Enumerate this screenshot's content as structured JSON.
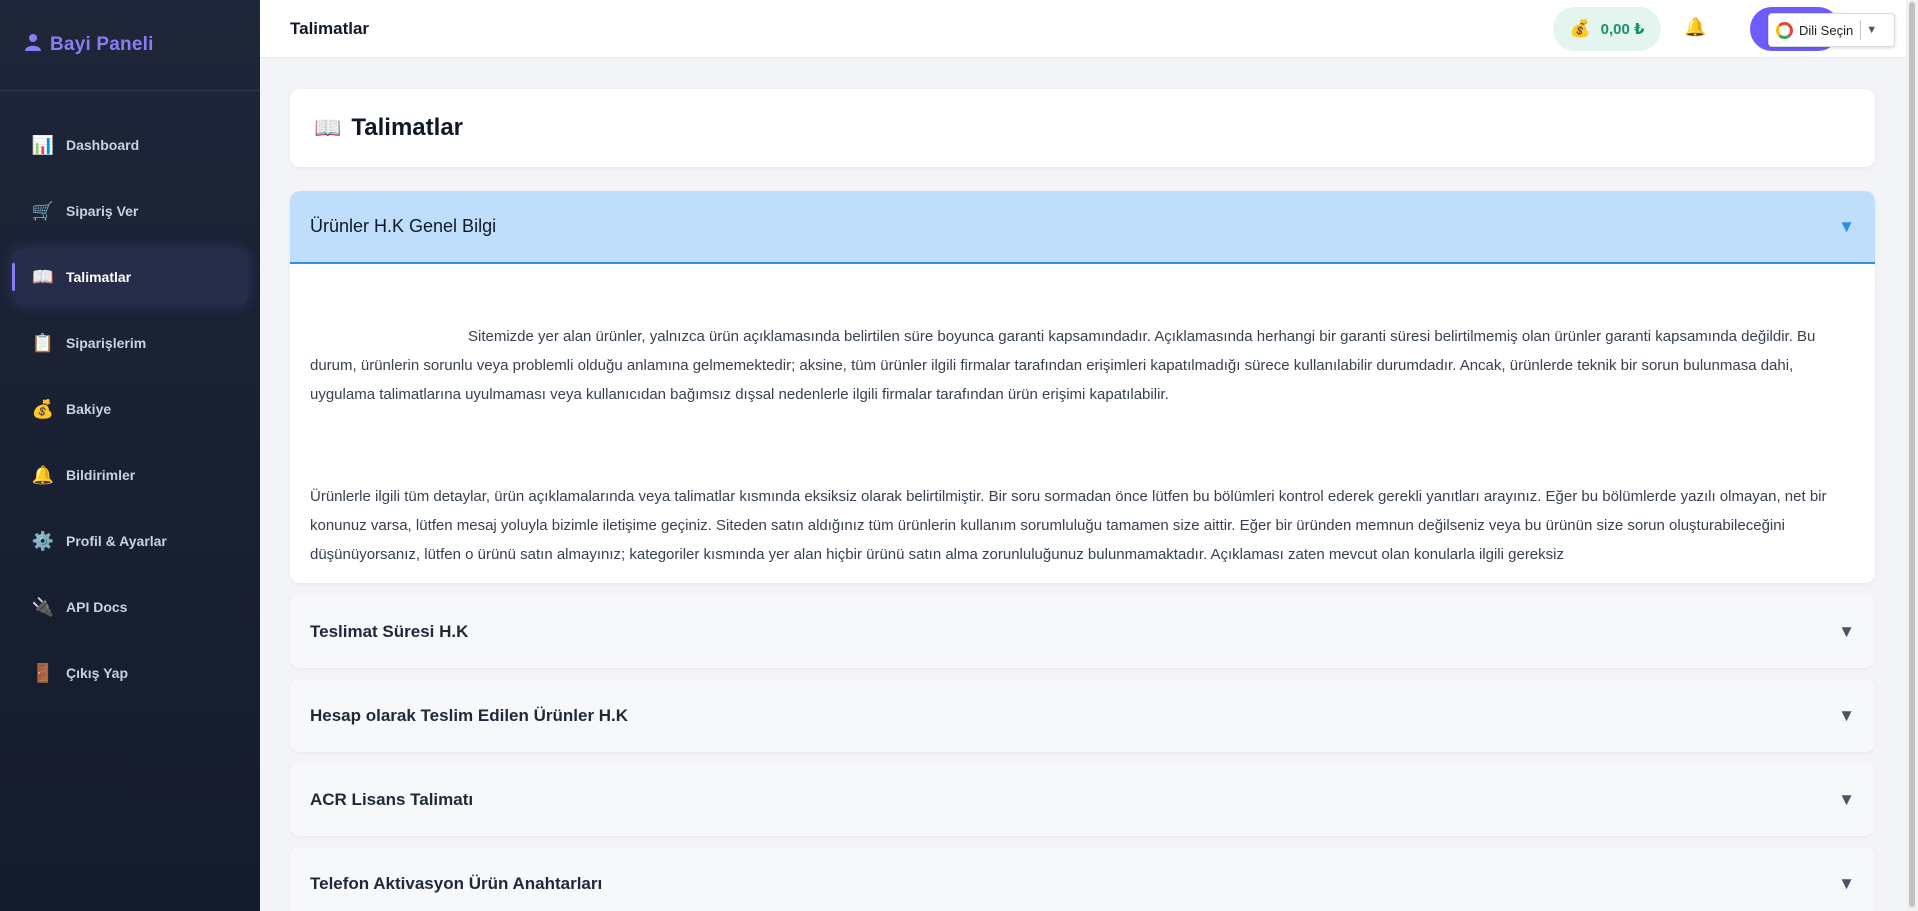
{
  "brand": {
    "icon": "user-icon",
    "title": "Bayi Paneli",
    "color": "#8b7cf6"
  },
  "sidebar": {
    "items": [
      {
        "icon": "📊",
        "icon_name": "dashboard-chart-icon",
        "label": "Dashboard",
        "active": false
      },
      {
        "icon": "🛒",
        "icon_name": "cart-icon",
        "label": "Sipariş Ver",
        "active": false
      },
      {
        "icon": "📖",
        "icon_name": "book-icon",
        "label": "Talimatlar",
        "active": true
      },
      {
        "icon": "📋",
        "icon_name": "clipboard-icon",
        "label": "Siparişlerim",
        "active": false
      },
      {
        "icon": "💰",
        "icon_name": "money-bag-icon",
        "label": "Bakiye",
        "active": false
      },
      {
        "icon": "🔔",
        "icon_name": "bell-icon",
        "label": "Bildirimler",
        "active": false
      },
      {
        "icon": "⚙️",
        "icon_name": "gear-icon",
        "label": "Profil & Ayarlar",
        "active": false
      },
      {
        "icon": "🔌",
        "icon_name": "plug-icon",
        "label": "API Docs",
        "active": false
      },
      {
        "icon": "🚪",
        "icon_name": "door-icon",
        "label": "Çıkış Yap",
        "active": false
      }
    ]
  },
  "topbar": {
    "title": "Talimatlar",
    "balance": {
      "icon": "💰",
      "amount": "0,00 ₺",
      "color": "#14936b"
    },
    "bell_icon": "🔔",
    "language": {
      "label": "Dili Seçin",
      "arrow": "▼"
    }
  },
  "page": {
    "icon": "📖",
    "title": "Talimatlar"
  },
  "accordion": {
    "open_section": {
      "title": "Ürünler H.K Genel Bilgi",
      "arrow": "▼",
      "paragraphs": [
        "Sitemizde yer alan ürünler, yalnızca ürün açıklamasında belirtilen süre boyunca garanti kapsamındadır. Açıklamasında herhangi bir garanti süresi belirtilmemiş olan ürünler garanti kapsamında değildir. Bu durum, ürünlerin sorunlu veya problemli olduğu anlamına gelmemektedir; aksine, tüm ürünler ilgili firmalar tarafından erişimleri kapatılmadığı sürece kullanılabilir durumdadır. Ancak, ürünlerde teknik bir sorun bulunmasa dahi, uygulama talimatlarına uyulmaması veya kullanıcıdan bağımsız dışsal nedenlerle ilgili firmalar tarafından ürün erişimi kapatılabilir.",
        "Ürünlerle ilgili tüm detaylar, ürün açıklamalarında veya talimatlar kısmında eksiksiz olarak belirtilmiştir. Bir soru sormadan önce lütfen bu bölümleri kontrol ederek gerekli yanıtları arayınız. Eğer bu bölümlerde yazılı olmayan, net bir konunuz varsa, lütfen mesaj yoluyla bizimle iletişime geçiniz. Siteden satın aldığınız tüm ürünlerin kullanım sorumluluğu tamamen size aittir. Eğer bir üründen memnun değilseniz veya bu ürünün size sorun oluşturabileceğini düşünüyorsanız, lütfen o ürünü satın almayınız; kategoriler kısmında yer alan hiçbir ürünü satın alma zorunluluğunuz bulunmamaktadır. Açıklaması zaten mevcut olan konularla ilgili gereksiz"
      ]
    },
    "sections": [
      {
        "title": "Teslimat Süresi H.K",
        "arrow": "▼"
      },
      {
        "title": "Hesap olarak Teslim Edilen Ürünler H.K",
        "arrow": "▼"
      },
      {
        "title": "ACR Lisans Talimatı",
        "arrow": "▼"
      },
      {
        "title": "Telefon Aktivasyon Ürün Anahtarları",
        "arrow": "▼"
      }
    ]
  }
}
